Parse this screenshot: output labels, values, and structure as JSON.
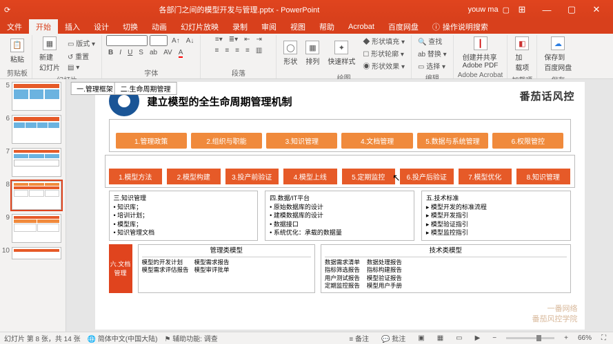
{
  "window": {
    "title": "各部门之间的模型开发与管理.pptx - PowerPoint",
    "user": "youw ma",
    "min": "—",
    "max": "▢",
    "close": "✕"
  },
  "tabs": {
    "file": "文件",
    "home": "开始",
    "insert": "插入",
    "design": "设计",
    "transition": "切换",
    "animation": "动画",
    "slideshow": "幻灯片放映",
    "record": "录制",
    "review": "审阅",
    "view": "视图",
    "help": "帮助",
    "acrobat": "Acrobat",
    "baidu": "百度网盘",
    "tell_icon": "ⓘ",
    "tell": "操作说明搜索"
  },
  "ribbon": {
    "clipboard": {
      "paste": "粘贴",
      "label": "剪贴板"
    },
    "slides": {
      "new": "新建\n幻灯片",
      "layout": "版式",
      "reset": "重置",
      "label": "幻灯片"
    },
    "font": {
      "label": "字体",
      "size": ""
    },
    "paragraph": {
      "label": "段落"
    },
    "drawing": {
      "shapes": "形状",
      "arrange": "排列",
      "quick": "快速样式",
      "fill": "形状填充",
      "outline": "形状轮廓",
      "effects": "形状效果",
      "label": "绘图"
    },
    "editing": {
      "find": "查找",
      "replace": "替换",
      "select": "选择",
      "label": "编辑"
    },
    "acrobat": {
      "create": "创建并共享\nAdobe PDF",
      "label": "Adobe Acrobat"
    },
    "addin": {
      "add": "加\n载项",
      "label": "加载项"
    },
    "save": {
      "btn": "保存到\n百度网盘",
      "label": "保存"
    }
  },
  "thumbs": {
    "5": "5",
    "6": "6",
    "7": "7",
    "8": "8",
    "9": "9",
    "10": "10"
  },
  "slide": {
    "title": "建立模型的全生命周期管理机制",
    "brand": "番茄话风控",
    "sec1": "一.管理框架",
    "r1": [
      "1.管理政策",
      "2.组织与职能",
      "3.知识管理",
      "4.文档管理",
      "5.数据与系统管理",
      "6.权限管控"
    ],
    "sec2": "二.生命周期管理",
    "r2": [
      "1.模型方法",
      "2.模型构建",
      "3.投产前验证",
      "4.模型上线",
      "5.定期监控",
      "6.投产后验证",
      "7.模型优化",
      "8.知识管理"
    ],
    "p3": {
      "title": "三.知识管理",
      "items": [
        "知识库；",
        "培训计划；",
        "模型库；",
        "知识管理文档"
      ]
    },
    "p4": {
      "title": "四.数据/IT平台",
      "items": [
        "原始数据库的设计",
        "建模数据库的设计",
        "数据接口",
        "系统优化：承载的数据量"
      ]
    },
    "p5": {
      "title": "五.技术标准",
      "items": [
        "模型开发的标准流程",
        "模型开发指引",
        "模型验证指引",
        "模型监控指引"
      ]
    },
    "doc_badge": "六.文档\n管理",
    "mgmt_head": "管理类模型",
    "mgmt_l": [
      "模型的开发计划",
      "模型需求评估报告"
    ],
    "mgmt_r": [
      "模型需求报告",
      "模型审评批单"
    ],
    "tech_head": "技术类模型",
    "tech_l": [
      "数据需求清单",
      "指标筛选报告",
      "用户测试报告",
      "定期监控报告"
    ],
    "tech_r": [
      "数据处理报告",
      "指标构建报告",
      "模型验证报告",
      "模型用户手册"
    ],
    "wm1": "一番网络",
    "wm2": "番茄风控学院"
  },
  "status": {
    "slide": "幻灯片 第 8 张，共 14 张",
    "lang": "简体中文(中国大陆)",
    "access": "辅助功能: 调查",
    "notes": "≡ 备注",
    "comments": "批注",
    "zoom": "66%"
  }
}
